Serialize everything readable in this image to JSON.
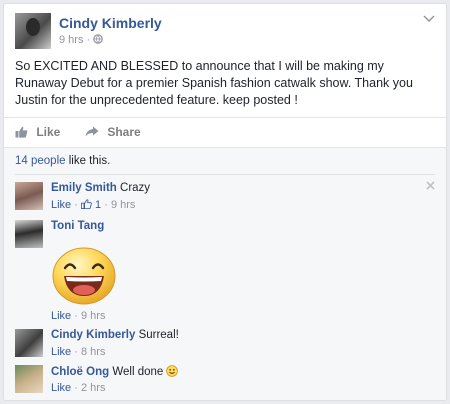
{
  "post": {
    "author": "Cindy Kimberly",
    "time": "9 hrs",
    "privacy_sep": "·",
    "text": "So EXCITED AND BLESSED to announce that I will be making my Runaway Debut for a premier Spanish fashion catwalk show. Thank you Justin for the unprecedented feature. keep posted !"
  },
  "actions": {
    "like": "Like",
    "share": "Share"
  },
  "likes": {
    "count_text": "14 people",
    "suffix": " like this."
  },
  "comments": [
    {
      "author": "Emily Smith",
      "text": "Crazy",
      "like": "Like",
      "sep": "·",
      "reactions": "1",
      "time": "9 hrs"
    },
    {
      "author": "Toni Tang",
      "text": "",
      "like": "Like",
      "time": "9 hrs"
    },
    {
      "author": "Cindy Kimberly",
      "text": "Surreal!",
      "like": "Like",
      "time": "8 hrs"
    },
    {
      "author": "Chloë Ong",
      "text": "Well done",
      "like": "Like",
      "time": "2 hrs"
    }
  ],
  "icons": [
    "avatar",
    "globe-icon",
    "chevron-down-icon",
    "like-thumb-icon",
    "share-arrow-icon",
    "close-icon",
    "big-smiley-icon",
    "smiley-icon"
  ],
  "colors": {
    "link": "#365899",
    "meta": "#90949c",
    "ufi_bg": "#f6f7f9"
  }
}
